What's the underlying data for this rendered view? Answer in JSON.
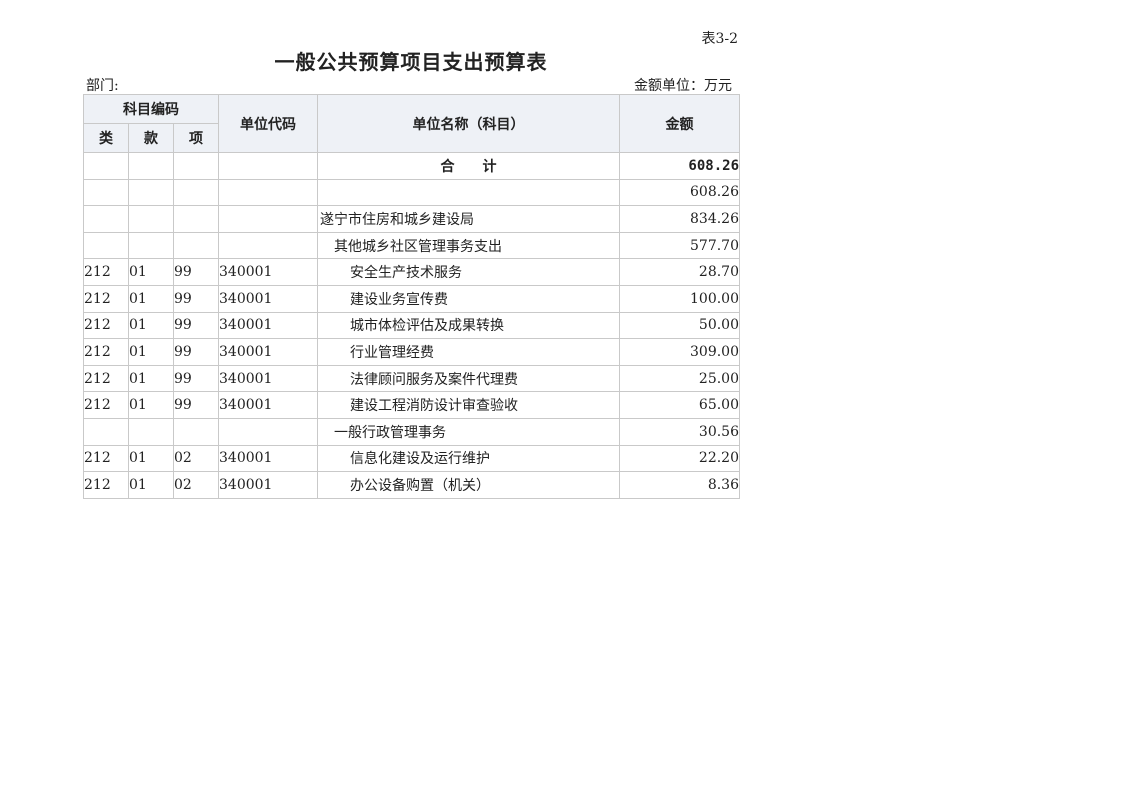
{
  "header": {
    "table_no": "表3-2",
    "title": "一般公共预算项目支出预算表",
    "dept_label": "部门:",
    "unit_label": "金额单位：万元"
  },
  "columns": {
    "subject_code": "科目编码",
    "class": "类",
    "section": "款",
    "item": "项",
    "unit_code": "单位代码",
    "unit_name": "单位名称（科目）",
    "amount": "金额"
  },
  "rows": [
    {
      "cls": "",
      "sec": "",
      "item": "",
      "code": "",
      "name": "合计",
      "amount": "608.26",
      "level": "total"
    },
    {
      "cls": "",
      "sec": "",
      "item": "",
      "code": "",
      "name": "",
      "amount": "608.26",
      "level": "lvl0"
    },
    {
      "cls": "",
      "sec": "",
      "item": "",
      "code": "",
      "name": "遂宁市住房和城乡建设局",
      "amount": "834.26",
      "level": "lvl0"
    },
    {
      "cls": "",
      "sec": "",
      "item": "",
      "code": "",
      "name": "其他城乡社区管理事务支出",
      "amount": "577.70",
      "level": "lvl1"
    },
    {
      "cls": "212",
      "sec": "01",
      "item": "99",
      "code": "340001",
      "name": "安全生产技术服务",
      "amount": "28.70",
      "level": "lvl2"
    },
    {
      "cls": "212",
      "sec": "01",
      "item": "99",
      "code": "340001",
      "name": "建设业务宣传费",
      "amount": "100.00",
      "level": "lvl2"
    },
    {
      "cls": "212",
      "sec": "01",
      "item": "99",
      "code": "340001",
      "name": "城市体检评估及成果转换",
      "amount": "50.00",
      "level": "lvl2"
    },
    {
      "cls": "212",
      "sec": "01",
      "item": "99",
      "code": "340001",
      "name": "行业管理经费",
      "amount": "309.00",
      "level": "lvl2"
    },
    {
      "cls": "212",
      "sec": "01",
      "item": "99",
      "code": "340001",
      "name": "法律顾问服务及案件代理费",
      "amount": "25.00",
      "level": "lvl2"
    },
    {
      "cls": "212",
      "sec": "01",
      "item": "99",
      "code": "340001",
      "name": "建设工程消防设计审查验收",
      "amount": "65.00",
      "level": "lvl2"
    },
    {
      "cls": "",
      "sec": "",
      "item": "",
      "code": "",
      "name": "一般行政管理事务",
      "amount": "30.56",
      "level": "lvl1"
    },
    {
      "cls": "212",
      "sec": "01",
      "item": "02",
      "code": "340001",
      "name": "信息化建设及运行维护",
      "amount": "22.20",
      "level": "lvl2"
    },
    {
      "cls": "212",
      "sec": "01",
      "item": "02",
      "code": "340001",
      "name": "办公设备购置（机关）",
      "amount": "8.36",
      "level": "lvl2"
    }
  ]
}
